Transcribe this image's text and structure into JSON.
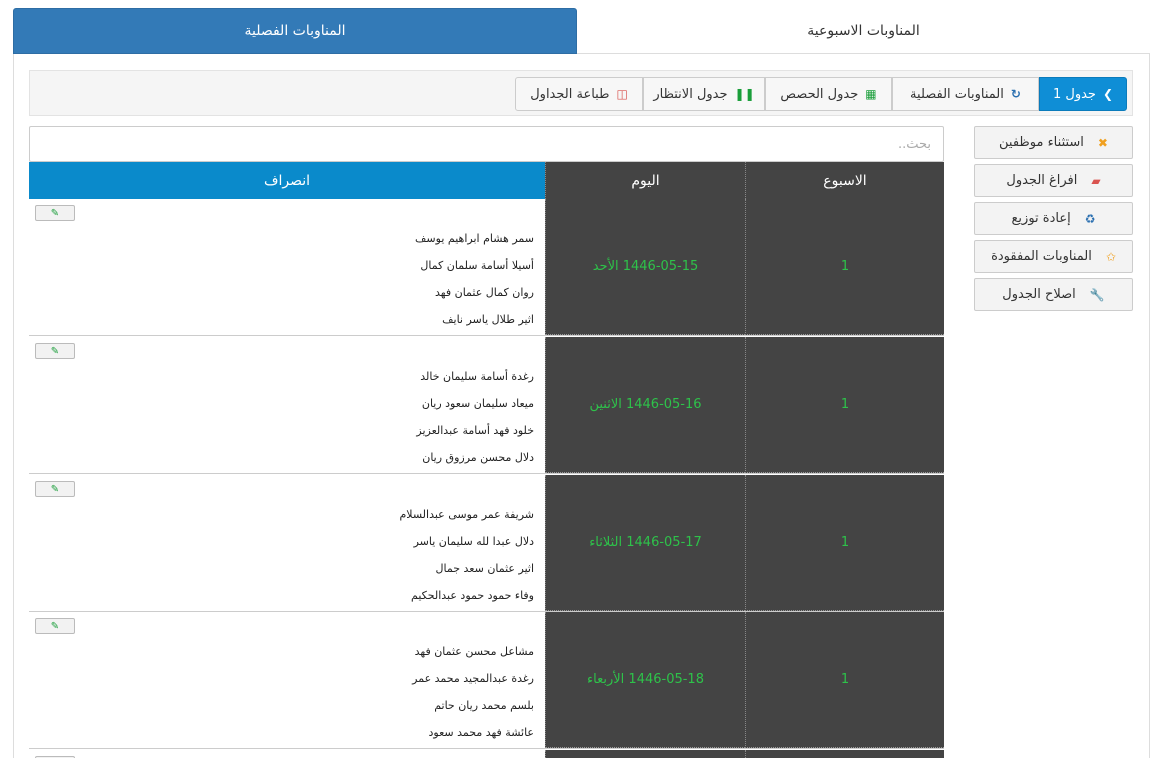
{
  "tabs": {
    "active": "المناوبات الفصلية",
    "inactive": "المناوبات الاسبوعية"
  },
  "toolbar": {
    "table_btn": "جدول 1",
    "seasonal_btn": "المناوبات الفصلية",
    "classes_btn": "جدول الحصص",
    "waiting_btn": "جدول الانتظار",
    "print_btn": "طباعة الجداول"
  },
  "search": {
    "placeholder": "بحث.."
  },
  "sidebar": {
    "exclude": "استثناء موظفين",
    "empty": "افراغ الجدول",
    "redistribute": "إعادة توزيع",
    "missing": "المناوبات المفقودة",
    "fix": "اصلاح الجدول"
  },
  "table": {
    "headers": {
      "week": "الاسبوع",
      "day": "اليوم",
      "leave": "انصراف"
    },
    "rows": [
      {
        "week": "1",
        "day": "1446-05-15 الأحد",
        "names": [
          "سمر هشام ابراهيم يوسف",
          "أسيلا أسامة سلمان كمال",
          "روان كمال عثمان فهد",
          "اثير طلال ياسر نايف"
        ]
      },
      {
        "week": "1",
        "day": "1446-05-16 الاثنين",
        "names": [
          "رغدة أسامة سليمان خالد",
          "ميعاد سليمان سعود ريان",
          "خلود فهد أسامة عبدالعزيز",
          "دلال محسن مرزوق ريان"
        ]
      },
      {
        "week": "1",
        "day": "1446-05-17 الثلاثاء",
        "names": [
          "شريفة عمر موسى عبدالسلام",
          "دلال عبدا لله سليمان ياسر",
          "اثير عثمان سعد جمال",
          "وفاء حمود حمود عبدالحكيم"
        ]
      },
      {
        "week": "1",
        "day": "1446-05-18 الأربعاء",
        "names": [
          "مشاعل محسن عثمان فهد",
          "رغدة عبدالمجيد محمد عمر",
          "بلسم محمد ريان حاتم",
          "عائشة فهد محمد سعود"
        ]
      }
    ]
  },
  "colors": {
    "primary": "#337ab7",
    "header_blue": "#0a8acb",
    "dark": "#444444",
    "green_text": "#2ec24a"
  }
}
